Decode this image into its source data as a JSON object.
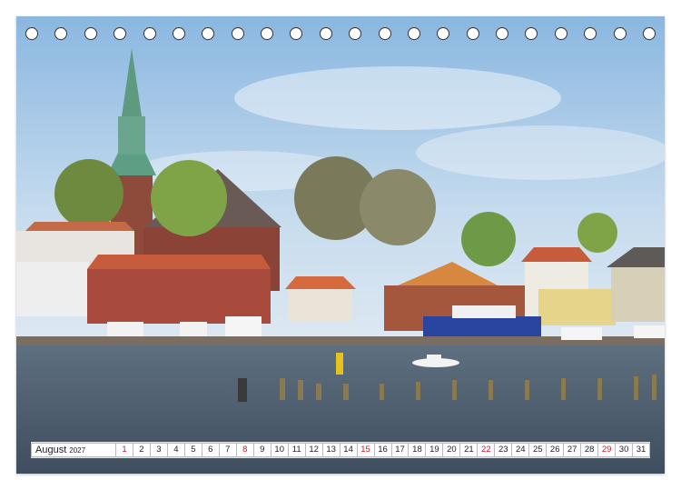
{
  "calendar": {
    "month": "August",
    "year": "2027",
    "days": [
      {
        "n": "1",
        "red": true
      },
      {
        "n": "2",
        "red": false
      },
      {
        "n": "3",
        "red": false
      },
      {
        "n": "4",
        "red": false
      },
      {
        "n": "5",
        "red": false
      },
      {
        "n": "6",
        "red": false
      },
      {
        "n": "7",
        "red": false
      },
      {
        "n": "8",
        "red": true
      },
      {
        "n": "9",
        "red": false
      },
      {
        "n": "10",
        "red": false
      },
      {
        "n": "11",
        "red": false
      },
      {
        "n": "12",
        "red": false
      },
      {
        "n": "13",
        "red": false
      },
      {
        "n": "14",
        "red": false
      },
      {
        "n": "15",
        "red": true
      },
      {
        "n": "16",
        "red": false
      },
      {
        "n": "17",
        "red": false
      },
      {
        "n": "18",
        "red": false
      },
      {
        "n": "19",
        "red": false
      },
      {
        "n": "20",
        "red": false
      },
      {
        "n": "21",
        "red": false
      },
      {
        "n": "22",
        "red": true
      },
      {
        "n": "23",
        "red": false
      },
      {
        "n": "24",
        "red": false
      },
      {
        "n": "25",
        "red": false
      },
      {
        "n": "26",
        "red": false
      },
      {
        "n": "27",
        "red": false
      },
      {
        "n": "28",
        "red": false
      },
      {
        "n": "29",
        "red": true
      },
      {
        "n": "30",
        "red": false
      },
      {
        "n": "31",
        "red": false
      }
    ]
  },
  "binding": {
    "ring_count": 22
  },
  "colors": {
    "sunday": "#d0162a",
    "sky": "#9fc3e2",
    "water": "#4a5a6b"
  }
}
